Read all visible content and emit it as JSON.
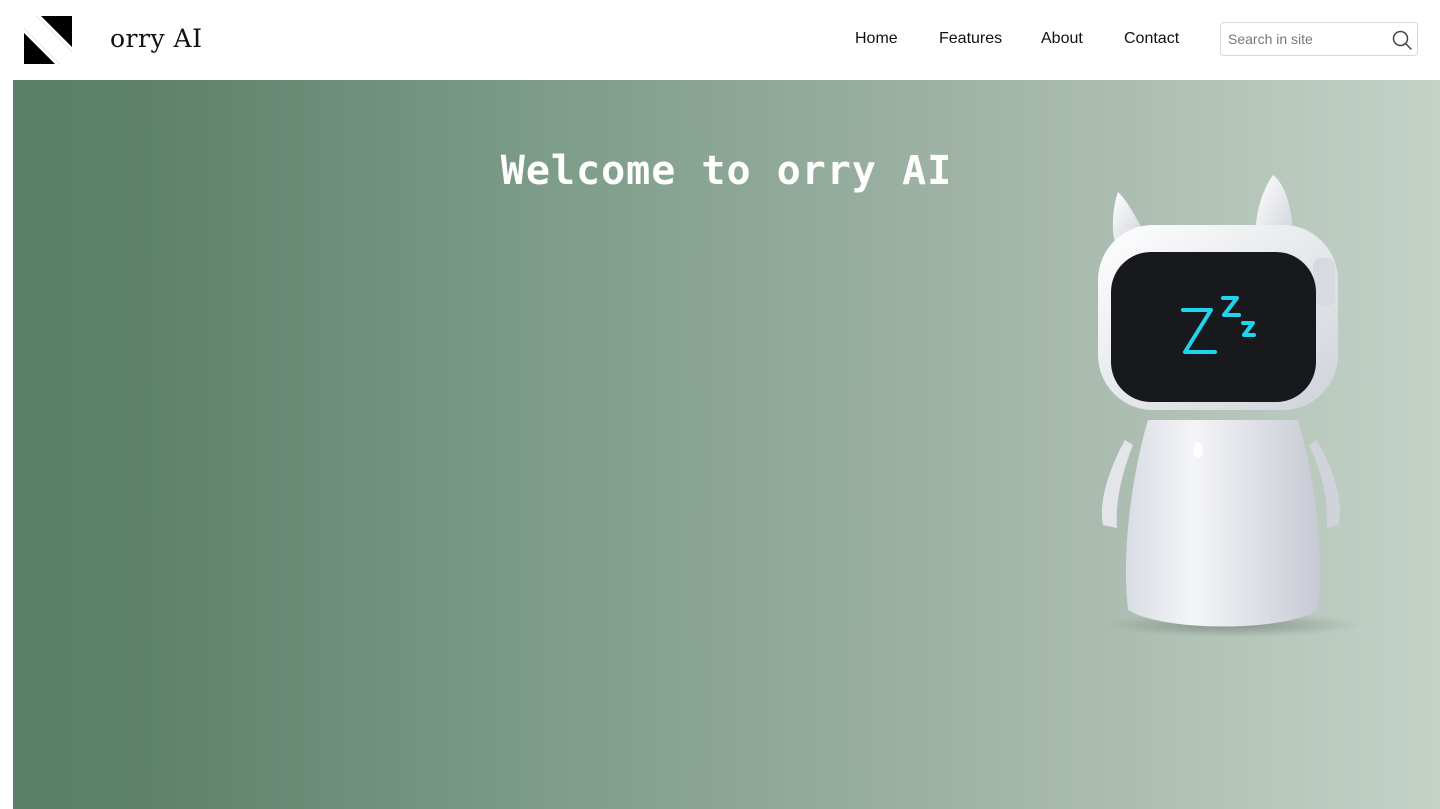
{
  "header": {
    "logo_icon": "stylized-n-logo-icon",
    "brand": "orry AI",
    "nav": [
      {
        "label": "Home"
      },
      {
        "label": "Features"
      },
      {
        "label": "About"
      },
      {
        "label": "Contact"
      }
    ],
    "search": {
      "placeholder": "Search in site",
      "value": "",
      "icon": "search-icon"
    }
  },
  "hero": {
    "title": "Welcome to orry AI",
    "image": "sleeping-robot-illustration",
    "screen_icon": "zzz-icon",
    "colors": {
      "gradient_start": "#5c7f69",
      "gradient_end": "#c4d2c8",
      "screen_glow": "#22d3ee"
    }
  }
}
